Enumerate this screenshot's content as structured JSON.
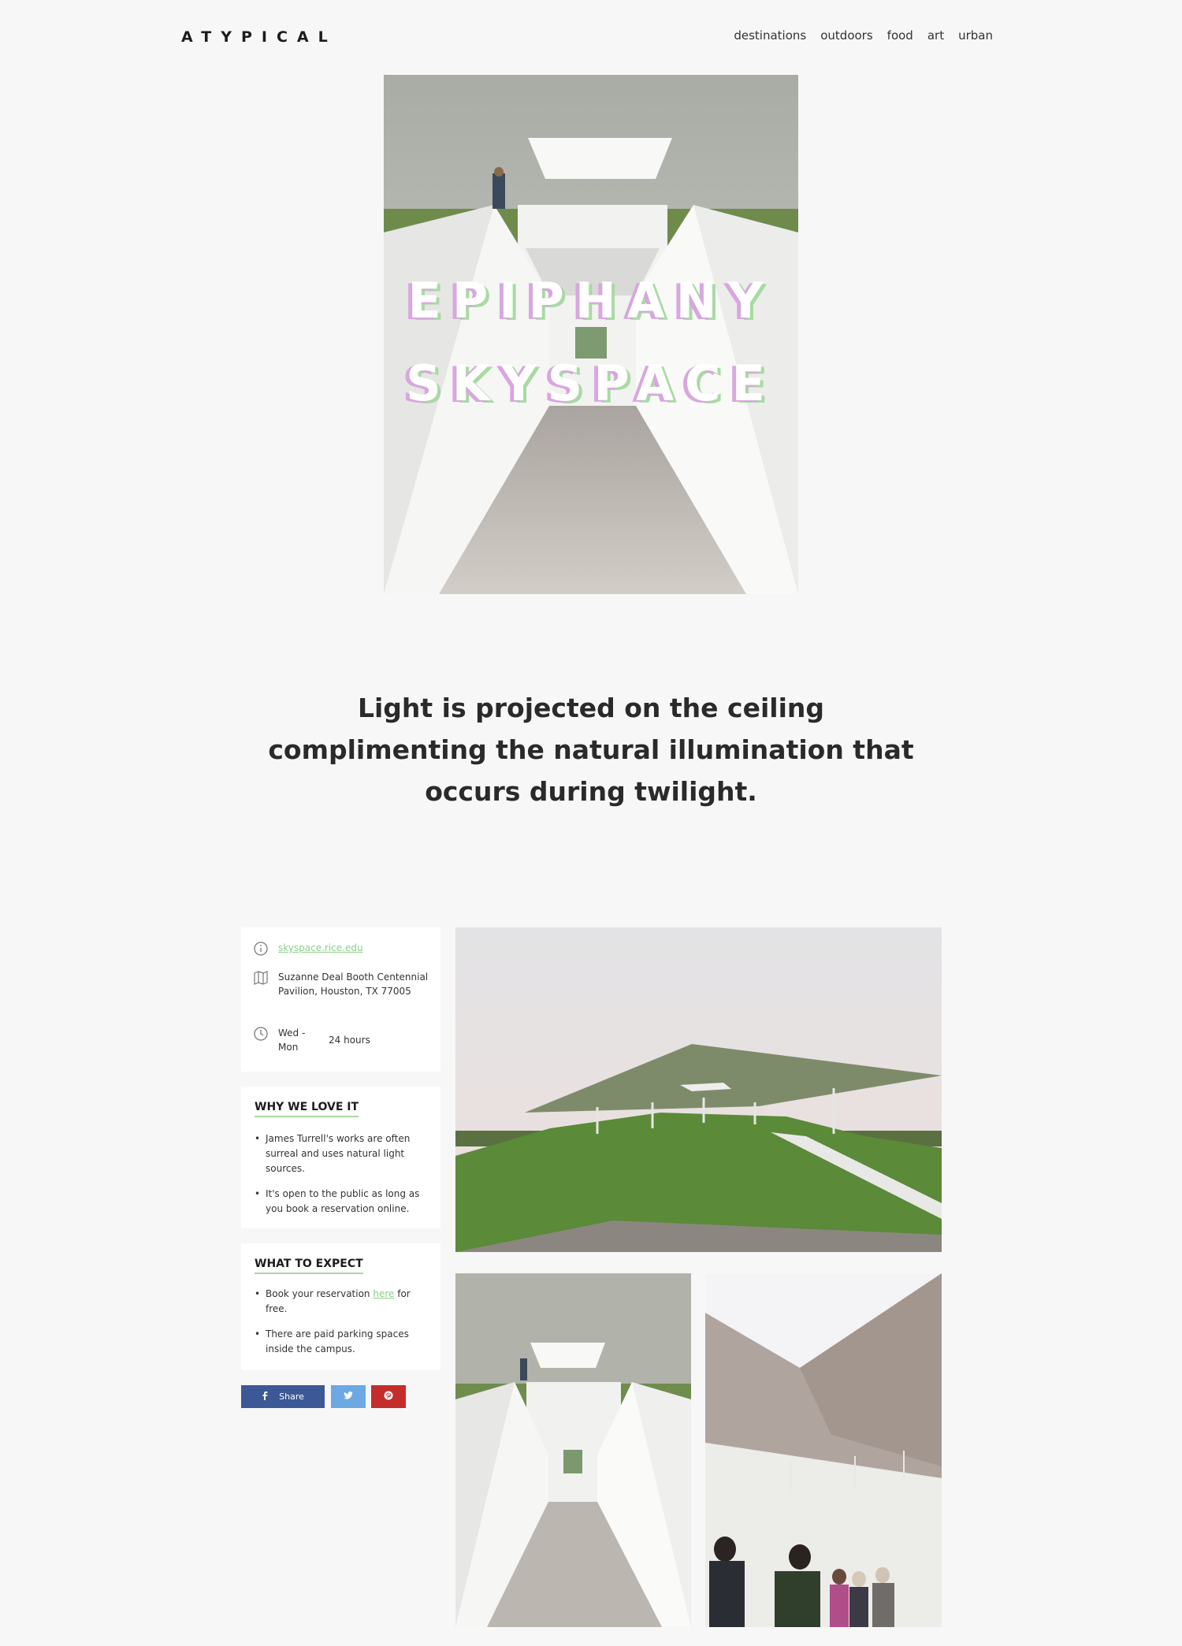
{
  "header": {
    "logo": "ATYPICAL",
    "nav": [
      "destinations",
      "outdoors",
      "food",
      "art",
      "urban"
    ]
  },
  "hero": {
    "title_line1": "EPIPHANY",
    "title_line2": "SKYSPACE"
  },
  "headline": "Light is projected on the ceiling complimenting the natural illumination that occurs during twilight.",
  "info": {
    "website": "skyspace.rice.edu",
    "address": "Suzanne Deal Booth Centennial Pavilion, Houston, TX 77005",
    "days": "Wed - Mon",
    "hours": "24 hours"
  },
  "why": {
    "heading": "WHY WE LOVE IT",
    "items": [
      "James Turrell's works are often surreal and uses natural light sources.",
      "It's open to the public as long as you book a reservation online."
    ]
  },
  "expect": {
    "heading": "WHAT TO EXPECT",
    "item1_prefix": "Book your reservation ",
    "item1_link": "here",
    "item1_suffix": " for free.",
    "item2": "There are paid parking spaces inside the campus."
  },
  "share": {
    "facebook_label": "Share"
  },
  "colors": {
    "background": "#f7f7f7",
    "accent_green": "#a9d9a4",
    "accent_pink": "#d7a7de",
    "facebook": "#3c5897",
    "twitter": "#6ca9e3",
    "pinterest": "#c52d2d"
  }
}
